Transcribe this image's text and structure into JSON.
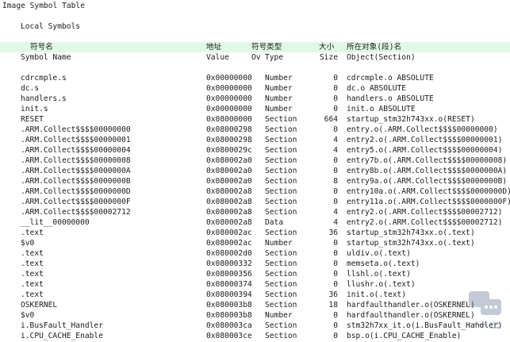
{
  "title": "Image Symbol Table",
  "section_title": "Local Symbols",
  "header_cn": {
    "name": "符号名",
    "value": "地址",
    "type": "符号类型",
    "size": "大小",
    "object": "所在对象(段)名"
  },
  "header_en": {
    "name": "Symbol Name",
    "value": "Value",
    "ov": "Ov",
    "type": "Type",
    "size": "Size",
    "object": "Object(Section)"
  },
  "rows": [
    {
      "name": "cdrcmple.s",
      "value": "0x00000000",
      "type": "Number",
      "size": "0",
      "object": "cdrcmple.o ABSOLUTE"
    },
    {
      "name": "dc.s",
      "value": "0x00000000",
      "type": "Number",
      "size": "0",
      "object": "dc.o ABSOLUTE"
    },
    {
      "name": "handlers.s",
      "value": "0x00000000",
      "type": "Number",
      "size": "0",
      "object": "handlers.o ABSOLUTE"
    },
    {
      "name": "init.s",
      "value": "0x00000000",
      "type": "Number",
      "size": "0",
      "object": "init.o ABSOLUTE"
    },
    {
      "name": "RESET",
      "value": "0x08000000",
      "type": "Section",
      "size": "664",
      "object": "startup_stm32h743xx.o(RESET)"
    },
    {
      "name": ".ARM.Collect$$$$00000000",
      "value": "0x08000298",
      "type": "Section",
      "size": "0",
      "object": "entry.o(.ARM.Collect$$$$00000000)"
    },
    {
      "name": ".ARM.Collect$$$$00000001",
      "value": "0x08000298",
      "type": "Section",
      "size": "4",
      "object": "entry2.o(.ARM.Collect$$$$00000001)"
    },
    {
      "name": ".ARM.Collect$$$$00000004",
      "value": "0x0800029c",
      "type": "Section",
      "size": "4",
      "object": "entry5.o(.ARM.Collect$$$$00000004)"
    },
    {
      "name": ".ARM.Collect$$$$00000008",
      "value": "0x080002a0",
      "type": "Section",
      "size": "0",
      "object": "entry7b.o(.ARM.Collect$$$$00000008)"
    },
    {
      "name": ".ARM.Collect$$$$0000000A",
      "value": "0x080002a0",
      "type": "Section",
      "size": "0",
      "object": "entry8b.o(.ARM.Collect$$$$0000000A)"
    },
    {
      "name": ".ARM.Collect$$$$0000000B",
      "value": "0x080002a0",
      "type": "Section",
      "size": "8",
      "object": "entry9a.o(.ARM.Collect$$$$0000000B)"
    },
    {
      "name": ".ARM.Collect$$$$0000000D",
      "value": "0x080002a8",
      "type": "Section",
      "size": "0",
      "object": "entry10a.o(.ARM.Collect$$$$0000000D)"
    },
    {
      "name": ".ARM.Collect$$$$0000000F",
      "value": "0x080002a8",
      "type": "Section",
      "size": "0",
      "object": "entry11a.o(.ARM.Collect$$$$0000000F)"
    },
    {
      "name": ".ARM.Collect$$$$00002712",
      "value": "0x080002a8",
      "type": "Section",
      "size": "4",
      "object": "entry2.o(.ARM.Collect$$$$00002712)"
    },
    {
      "name": "__lit__00000000",
      "value": "0x080002a8",
      "type": "Data",
      "size": "4",
      "object": "entry2.o(.ARM.Collect$$$$00002712)"
    },
    {
      "name": ".text",
      "value": "0x080002ac",
      "type": "Section",
      "size": "36",
      "object": "startup_stm32h743xx.o(.text)"
    },
    {
      "name": "$v0",
      "value": "0x080002ac",
      "type": "Number",
      "size": "0",
      "object": "startup_stm32h743xx.o(.text)"
    },
    {
      "name": ".text",
      "value": "0x080002d0",
      "type": "Section",
      "size": "0",
      "object": "uldiv.o(.text)"
    },
    {
      "name": ".text",
      "value": "0x08000332",
      "type": "Section",
      "size": "0",
      "object": "memseta.o(.text)"
    },
    {
      "name": ".text",
      "value": "0x08000356",
      "type": "Section",
      "size": "0",
      "object": "llshl.o(.text)"
    },
    {
      "name": ".text",
      "value": "0x08000374",
      "type": "Section",
      "size": "0",
      "object": "llushr.o(.text)"
    },
    {
      "name": ".text",
      "value": "0x08000394",
      "type": "Section",
      "size": "36",
      "object": "init.o(.text)"
    },
    {
      "name": "OSKERNEL",
      "value": "0x080003b8",
      "type": "Section",
      "size": "18",
      "object": "hardfaulthandler.o(OSKERNEL)"
    },
    {
      "name": "$v0",
      "value": "0x080003b8",
      "type": "Number",
      "size": "0",
      "object": "hardfaulthandler.o(OSKERNEL)"
    },
    {
      "name": "i.BusFault_Handler",
      "value": "0x080003ca",
      "type": "Section",
      "size": "0",
      "object": "stm32h7xx_it.o(i.BusFault_Handler)"
    },
    {
      "name": "i.CPU_CACHE_Enable",
      "value": "0x080003ce",
      "type": "Section",
      "size": "0",
      "object": "bsp.o(i.CPU_CACHE_Enable)"
    }
  ]
}
